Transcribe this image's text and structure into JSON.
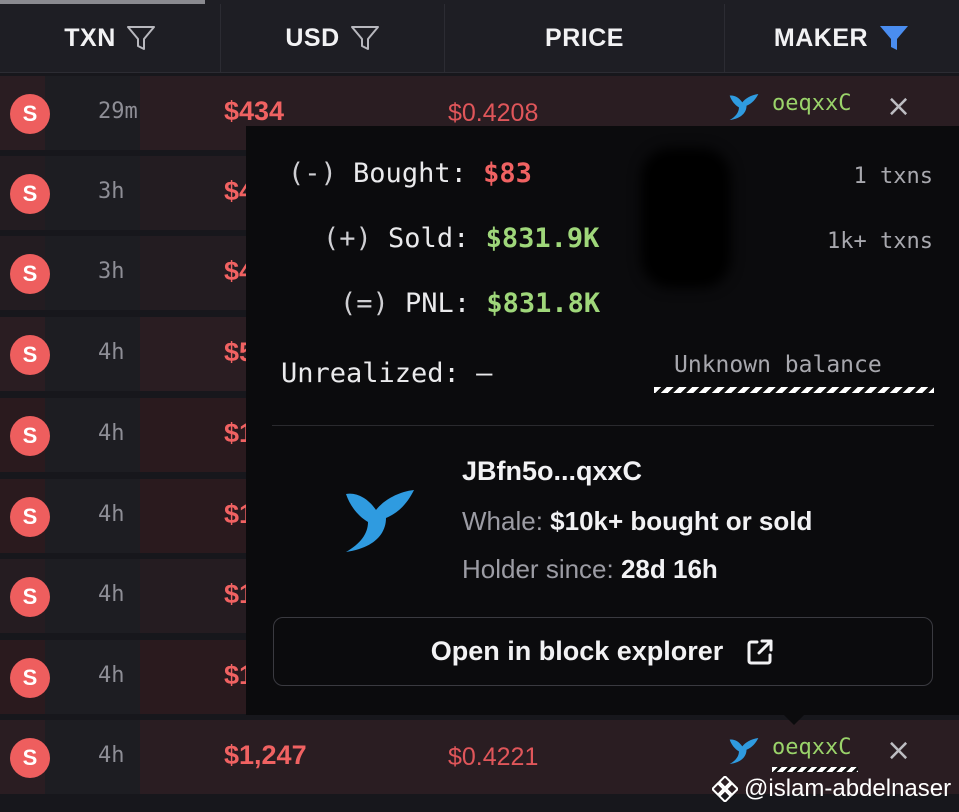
{
  "header": {
    "columns": [
      {
        "label": "TXN",
        "filter_icon": "filter-outline-icon"
      },
      {
        "label": "USD",
        "filter_icon": "filter-outline-icon"
      },
      {
        "label": "PRICE",
        "filter_icon": ""
      },
      {
        "label": "MAKER",
        "filter_icon": "filter-active-icon"
      }
    ]
  },
  "rows": [
    {
      "type": "S",
      "age": "29m",
      "usd": "$434",
      "price": "$0.4208",
      "maker": "oeqxxC",
      "close": "×"
    },
    {
      "type": "S",
      "age": "3h",
      "usd": "$4",
      "price": "",
      "maker": "",
      "close": ""
    },
    {
      "type": "S",
      "age": "3h",
      "usd": "$4",
      "price": "",
      "maker": "",
      "close": ""
    },
    {
      "type": "S",
      "age": "4h",
      "usd": "$5",
      "price": "",
      "maker": "",
      "close": ""
    },
    {
      "type": "S",
      "age": "4h",
      "usd": "$1",
      "price": "",
      "maker": "",
      "close": ""
    },
    {
      "type": "S",
      "age": "4h",
      "usd": "$1",
      "price": "",
      "maker": "",
      "close": ""
    },
    {
      "type": "S",
      "age": "4h",
      "usd": "$1",
      "price": "",
      "maker": "",
      "close": ""
    },
    {
      "type": "S",
      "age": "4h",
      "usd": "$1",
      "price": "",
      "maker": "",
      "close": ""
    },
    {
      "type": "S",
      "age": "4h",
      "usd": "$1,247",
      "price": "$0.4221",
      "maker": "oeqxxC",
      "close": "×"
    }
  ],
  "popover": {
    "bought": {
      "sign": "(-)",
      "label": "Bought:",
      "value": "$83",
      "txns": "1 txns"
    },
    "sold": {
      "sign": "(+)",
      "label": "Sold:",
      "value": "$831.9K",
      "txns": "1k+ txns"
    },
    "pnl": {
      "sign": "(=)",
      "label": "PNL:",
      "value": "$831.8K"
    },
    "unrealized": {
      "label": "Unrealized:",
      "value": "—",
      "balance": "Unknown balance"
    },
    "wallet": {
      "address": "JBfn5o...qxxC",
      "whale_label": "Whale:",
      "whale_desc": "$10k+ bought or sold",
      "holder_label": "Holder since:",
      "holder_value": "28d 16h",
      "icon": "whale-icon"
    },
    "explorer_button": "Open in block explorer"
  },
  "watermark": "@islam-abdelnaser",
  "colors": {
    "sell_red": "#f06262",
    "badge_red": "#ee5e5e",
    "profit_green": "#9fd77a",
    "whale_blue": "#2f9be0",
    "filter_active": "#4a8df0"
  }
}
